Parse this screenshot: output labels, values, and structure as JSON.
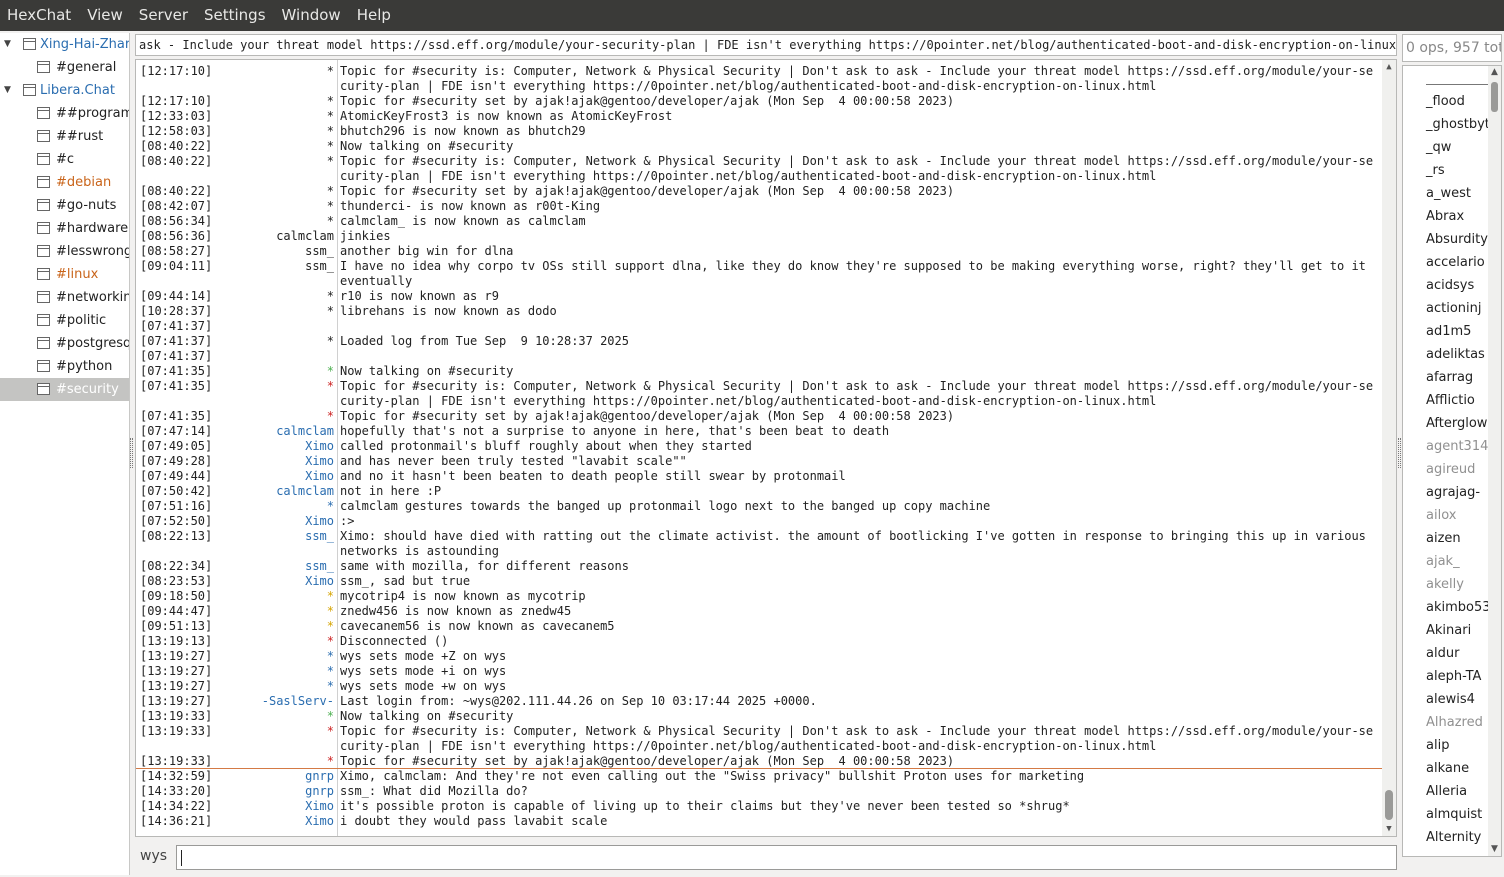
{
  "menubar": [
    "HexChat",
    "View",
    "Server",
    "Settings",
    "Window",
    "Help"
  ],
  "tree": [
    {
      "type": "network",
      "label": "Xing-Hai-Zhar"
    },
    {
      "type": "channel",
      "label": "#general"
    },
    {
      "type": "network",
      "label": "Libera.Chat"
    },
    {
      "type": "channel",
      "label": "##programm"
    },
    {
      "type": "channel",
      "label": "##rust"
    },
    {
      "type": "channel",
      "label": "#c"
    },
    {
      "type": "channel",
      "label": "#debian",
      "highlight": true
    },
    {
      "type": "channel",
      "label": "#go-nuts"
    },
    {
      "type": "channel",
      "label": "#hardware"
    },
    {
      "type": "channel",
      "label": "#lesswrong"
    },
    {
      "type": "channel",
      "label": "#linux",
      "highlight": true
    },
    {
      "type": "channel",
      "label": "#networkin"
    },
    {
      "type": "channel",
      "label": "#politic"
    },
    {
      "type": "channel",
      "label": "#postgresq"
    },
    {
      "type": "channel",
      "label": "#python"
    },
    {
      "type": "channel",
      "label": "#security",
      "selected": true
    }
  ],
  "topic": "ask - Include your threat model https://ssd.eff.org/module/your-security-plan | FDE isn't everything https://0pointer.net/blog/authenticated-boot-and-disk-encryption-on-linux.html",
  "user_count": "0 ops, 957 total",
  "chat": [
    {
      "time": "[12:17:10]",
      "nick": "*",
      "msg": "Topic for #security is: Computer, Network & Physical Security | Don't ask to ask - Include your threat model https://ssd.eff.org/module/your-security-plan | FDE isn't everything https://0pointer.net/blog/authenticated-boot-and-disk-encryption-on-linux.html",
      "rows": 2
    },
    {
      "time": "[12:17:10]",
      "nick": "*",
      "msg": "Topic for #security set by ajak!ajak@gentoo/developer/ajak (Mon Sep  4 00:00:58 2023)"
    },
    {
      "time": "[12:33:03]",
      "nick": "*",
      "msg": "AtomicKeyFrost3 is now known as AtomicKeyFrost"
    },
    {
      "time": "[12:58:03]",
      "nick": "*",
      "msg": "bhutch296 is now known as bhutch29"
    },
    {
      "time": "[08:40:22]",
      "nick": "*",
      "msg": "Now talking on #security"
    },
    {
      "time": "[08:40:22]",
      "nick": "*",
      "msg": "Topic for #security is: Computer, Network & Physical Security | Don't ask to ask - Include your threat model https://ssd.eff.org/module/your-security-plan | FDE isn't everything https://0pointer.net/blog/authenticated-boot-and-disk-encryption-on-linux.html",
      "rows": 2
    },
    {
      "time": "[08:40:22]",
      "nick": "*",
      "msg": "Topic for #security set by ajak!ajak@gentoo/developer/ajak (Mon Sep  4 00:00:58 2023)"
    },
    {
      "time": "[08:42:07]",
      "nick": "*",
      "msg": "thunderci- is now known as r00t-King"
    },
    {
      "time": "[08:56:34]",
      "nick": "*",
      "msg": "calmclam_ is now known as calmclam"
    },
    {
      "time": "[08:56:36]",
      "nick": "calmclam",
      "msg": "jinkies"
    },
    {
      "time": "[08:58:27]",
      "nick": "ssm_",
      "msg": "another big win for dlna"
    },
    {
      "time": "[09:04:11]",
      "nick": "ssm_",
      "msg": "I have no idea why corpo tv OSs still support dlna, like they do know they're supposed to be making everything worse, right? they'll get to it eventually",
      "rows": 2
    },
    {
      "time": "[09:44:14]",
      "nick": "*",
      "msg": "r10 is now known as r9"
    },
    {
      "time": "[10:28:37]",
      "nick": "*",
      "msg": "librehans is now known as dodo"
    },
    {
      "time": "[07:41:37]",
      "nick": "",
      "msg": ""
    },
    {
      "time": "[07:41:37]",
      "nick": "*",
      "msg": "Loaded log from Tue Sep  9 10:28:37 2025"
    },
    {
      "time": "[07:41:37]",
      "nick": "",
      "msg": ""
    },
    {
      "time": "[07:41:35]",
      "nick": "*",
      "nick_color": "green",
      "msg": "Now talking on #security"
    },
    {
      "time": "[07:41:35]",
      "nick": "*",
      "nick_color": "red",
      "msg": "Topic for #security is: Computer, Network & Physical Security | Don't ask to ask - Include your threat model https://ssd.eff.org/module/your-security-plan | FDE isn't everything https://0pointer.net/blog/authenticated-boot-and-disk-encryption-on-linux.html",
      "rows": 2
    },
    {
      "time": "[07:41:35]",
      "nick": "*",
      "nick_color": "red",
      "msg": "Topic for #security set by ajak!ajak@gentoo/developer/ajak (Mon Sep  4 00:00:58 2023)"
    },
    {
      "time": "[07:47:14]",
      "nick": "calmclam",
      "nick_color": "blue",
      "msg": "hopefully that's not a surprise to anyone in here, that's been beat to death"
    },
    {
      "time": "[07:49:05]",
      "nick": "Ximo",
      "nick_color": "blue",
      "msg": "called protonmail's bluff roughly about when they started"
    },
    {
      "time": "[07:49:28]",
      "nick": "Ximo",
      "nick_color": "blue",
      "msg": "and has never been truly tested \"lavabit scale\"\""
    },
    {
      "time": "[07:49:44]",
      "nick": "Ximo",
      "nick_color": "blue",
      "msg": "and no it hasn't been beaten to death people still swear by protonmail"
    },
    {
      "time": "[07:50:42]",
      "nick": "calmclam",
      "nick_color": "blue",
      "msg": "not in here :P"
    },
    {
      "time": "[07:51:16]",
      "nick": "*",
      "nick_color": "blue",
      "msg": "calmclam gestures towards the banged up protonmail logo next to the banged up copy machine"
    },
    {
      "time": "[07:52:50]",
      "nick": "Ximo",
      "nick_color": "blue",
      "msg": ":>"
    },
    {
      "time": "[08:22:13]",
      "nick": "ssm_",
      "nick_color": "blue",
      "msg": "Ximo: should have died with ratting out the climate activist. the amount of bootlicking I've gotten in response to bringing this up in various networks is astounding",
      "rows": 2
    },
    {
      "time": "[08:22:34]",
      "nick": "ssm_",
      "nick_color": "blue",
      "msg": "same with mozilla, for different reasons"
    },
    {
      "time": "[08:23:53]",
      "nick": "Ximo",
      "nick_color": "blue",
      "msg": "ssm_, sad but true"
    },
    {
      "time": "[09:18:50]",
      "nick": "*",
      "nick_color": "yellow",
      "msg": "mycotrip4 is now known as mycotrip"
    },
    {
      "time": "[09:44:47]",
      "nick": "*",
      "nick_color": "yellow",
      "msg": "znedw456 is now known as znedw45"
    },
    {
      "time": "[09:51:13]",
      "nick": "*",
      "nick_color": "yellow",
      "msg": "cavecanem56 is now known as cavecanem5"
    },
    {
      "time": "[13:19:13]",
      "nick": "*",
      "nick_color": "red",
      "msg": "Disconnected ()"
    },
    {
      "time": "[13:19:27]",
      "nick": "*",
      "nick_color": "blue",
      "msg": "wys sets mode +Z on wys"
    },
    {
      "time": "[13:19:27]",
      "nick": "*",
      "nick_color": "blue",
      "msg": "wys sets mode +i on wys"
    },
    {
      "time": "[13:19:27]",
      "nick": "*",
      "nick_color": "blue",
      "msg": "wys sets mode +w on wys"
    },
    {
      "time": "[13:19:27]",
      "nick": "-SaslServ-",
      "nick_color": "blue",
      "msg": "Last login from: ~wys@202.111.44.26 on Sep 10 03:17:44 2025 +0000."
    },
    {
      "time": "[13:19:33]",
      "nick": "*",
      "nick_color": "green",
      "msg": "Now talking on #security"
    },
    {
      "time": "[13:19:33]",
      "nick": "*",
      "nick_color": "red",
      "msg": "Topic for #security is: Computer, Network & Physical Security | Don't ask to ask - Include your threat model https://ssd.eff.org/module/your-security-plan | FDE isn't everything https://0pointer.net/blog/authenticated-boot-and-disk-encryption-on-linux.html",
      "rows": 2
    },
    {
      "time": "[13:19:33]",
      "nick": "*",
      "nick_color": "red",
      "msg": "Topic for #security set by ajak!ajak@gentoo/developer/ajak (Mon Sep  4 00:00:58 2023)"
    },
    {
      "time": "[14:32:59]",
      "nick": "gnrp",
      "nick_color": "blue",
      "msg": "Ximo, calmclam: And they're not even calling out the \"Swiss privacy\" bullshit Proton uses for marketing",
      "marker_before": true
    },
    {
      "time": "[14:33:20]",
      "nick": "gnrp",
      "nick_color": "blue",
      "msg": "ssm_: What did Mozilla do?"
    },
    {
      "time": "[14:34:22]",
      "nick": "Ximo",
      "nick_color": "blue",
      "msg": "it's possible proton is capable of living up to their claims but they've never been tested so *shrug*"
    },
    {
      "time": "[14:36:21]",
      "nick": "Ximo",
      "nick_color": "blue",
      "msg": "i doubt they would pass lavabit scale"
    }
  ],
  "users": [
    {
      "name": ""
    },
    {
      "name": "_flood"
    },
    {
      "name": "_ghostbyt"
    },
    {
      "name": "_qw"
    },
    {
      "name": "_rs"
    },
    {
      "name": "a_west"
    },
    {
      "name": "Abrax"
    },
    {
      "name": "Absurdity"
    },
    {
      "name": "accelario"
    },
    {
      "name": "acidsys"
    },
    {
      "name": "actioninj"
    },
    {
      "name": "ad1m5"
    },
    {
      "name": "adeliktas"
    },
    {
      "name": "afarrag"
    },
    {
      "name": "Afflictio"
    },
    {
      "name": "Afterglow"
    },
    {
      "name": "agent314",
      "away": true
    },
    {
      "name": "agireud",
      "away": true
    },
    {
      "name": "agrajag-"
    },
    {
      "name": "ailox",
      "away": true
    },
    {
      "name": "aizen"
    },
    {
      "name": "ajak_",
      "away": true
    },
    {
      "name": "akelly",
      "away": true
    },
    {
      "name": "akimbo533"
    },
    {
      "name": "Akinari"
    },
    {
      "name": "aldur"
    },
    {
      "name": "aleph-TA"
    },
    {
      "name": "alewis4"
    },
    {
      "name": "Alhazred",
      "away": true
    },
    {
      "name": "alip"
    },
    {
      "name": "alkane"
    },
    {
      "name": "Alleria"
    },
    {
      "name": "almquist"
    },
    {
      "name": "Alternity"
    }
  ],
  "input": {
    "nick": "wys",
    "value": ""
  }
}
